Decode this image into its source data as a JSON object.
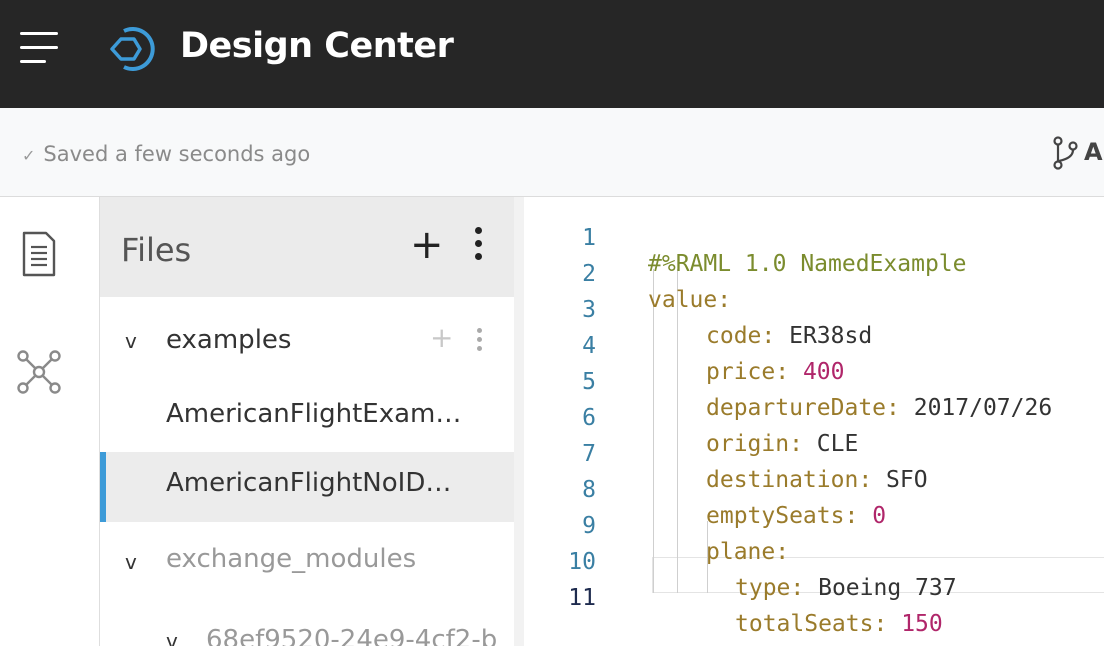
{
  "header": {
    "title": "Design Center"
  },
  "status": {
    "check_glyph": "✓",
    "saved_text": "Saved a few seconds ago",
    "branch_partial": "A"
  },
  "files": {
    "title": "Files",
    "add_glyph": "+",
    "tree": [
      {
        "label": "examples",
        "type": "folder",
        "expanded": true
      },
      {
        "label": "AmericanFlightExam…",
        "type": "file"
      },
      {
        "label": "AmericanFlightNoID…",
        "type": "file",
        "selected": true
      },
      {
        "label": "exchange_modules",
        "type": "folder",
        "expanded": true
      },
      {
        "label": "68ef9520-24e9-4cf2-b",
        "type": "folder",
        "expanded": true
      }
    ],
    "chevron_glyph": "v",
    "row_add_glyph": "+"
  },
  "editor": {
    "lines": [
      {
        "num": "1",
        "key": "#%RAML 1.0 NamedExample",
        "sep": "",
        "val": ""
      },
      {
        "num": "2",
        "key": "value",
        "sep": ":",
        "val": ""
      },
      {
        "num": "3",
        "key": "code",
        "sep": ": ",
        "val": "ER38sd"
      },
      {
        "num": "4",
        "key": "price",
        "sep": ": ",
        "val": "400"
      },
      {
        "num": "5",
        "key": "departureDate",
        "sep": ": ",
        "val": "2017/07/26"
      },
      {
        "num": "6",
        "key": "origin",
        "sep": ": ",
        "val": "CLE"
      },
      {
        "num": "7",
        "key": "destination",
        "sep": ": ",
        "val": "SFO"
      },
      {
        "num": "8",
        "key": "emptySeats",
        "sep": ": ",
        "val": "0"
      },
      {
        "num": "9",
        "key": "plane",
        "sep": ":",
        "val": ""
      },
      {
        "num": "10",
        "key": "type",
        "sep": ": ",
        "val": "Boeing 737"
      },
      {
        "num": "11",
        "key": "totalSeats",
        "sep": ": ",
        "val": "150"
      }
    ]
  },
  "colors": {
    "topbar": "#262626",
    "accent": "#3d9bd8",
    "yaml_key": "#9a7b2b",
    "yaml_number": "#b0266a",
    "yaml_directive": "#7b8c2e",
    "line_number": "#3a7fa3"
  }
}
